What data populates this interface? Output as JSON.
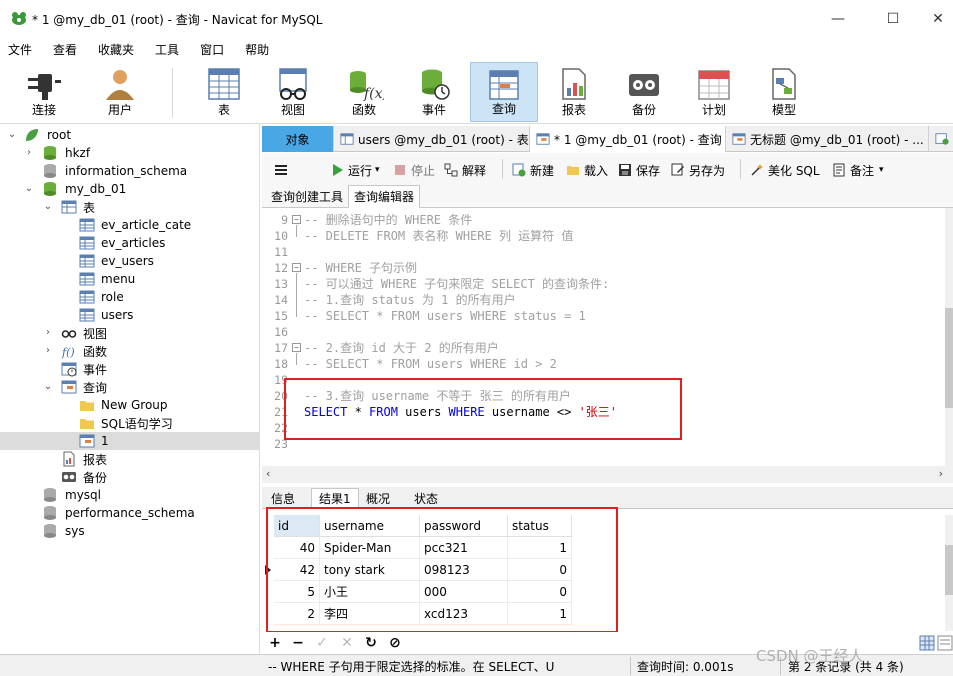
{
  "window": {
    "title": "* 1 @my_db_01 (root) - 查询 - Navicat for MySQL",
    "minimize": "—",
    "maximize": "☐",
    "close": "✕"
  },
  "menu": [
    "文件",
    "查看",
    "收藏夹",
    "工具",
    "窗口",
    "帮助"
  ],
  "ribbon": {
    "connect": "连接",
    "user": "用户",
    "table": "表",
    "view": "视图",
    "function": "函数",
    "event": "事件",
    "query": "查询",
    "report": "报表",
    "backup": "备份",
    "schedule": "计划",
    "model": "模型"
  },
  "tree": {
    "root": "root",
    "hkzf": "hkzf",
    "information_schema": "information_schema",
    "my_db_01": "my_db_01",
    "tables": "表",
    "table_items": [
      "ev_article_cate",
      "ev_articles",
      "ev_users",
      "menu",
      "role",
      "users"
    ],
    "views": "视图",
    "functions": "函数",
    "events": "事件",
    "queries": "查询",
    "query_items": [
      "New Group",
      "SQL语句学习",
      "1"
    ],
    "reports": "报表",
    "backups": "备份",
    "mysql": "mysql",
    "performance_schema": "performance_schema",
    "sys": "sys"
  },
  "tabs": {
    "objects": "对象",
    "tab1": "users @my_db_01 (root) - 表",
    "tab2": "* 1 @my_db_01 (root) - 查询",
    "tab3": "无标题 @my_db_01 (root) - ..."
  },
  "qtoolbar": {
    "run": "运行",
    "stop": "停止",
    "explain": "解释",
    "new": "新建",
    "load": "载入",
    "save": "保存",
    "save_as": "另存为",
    "beautify": "美化 SQL",
    "comment": "备注"
  },
  "subtabs": {
    "builder": "查询创建工具",
    "editor": "查询编辑器"
  },
  "editor": {
    "line_numbers": [
      "9",
      "10",
      "11",
      "12",
      "13",
      "14",
      "15",
      "16",
      "17",
      "18",
      "19",
      "20",
      "21",
      "22",
      "23"
    ],
    "l9": "-- 删除语句中的 WHERE 条件",
    "l10": "-- DELETE FROM 表名称 WHERE 列 运算符 值",
    "l12": "-- WHERE 子句示例",
    "l13": "-- 可以通过 WHERE 子句来限定 SELECT 的查询条件:",
    "l14": "-- 1.查询 status 为 1 的所有用户",
    "l15": "-- SELECT * FROM users WHERE status = 1",
    "l17": "-- 2.查询 id 大于 2 的所有用户",
    "l18": "-- SELECT * FROM users WHERE id > 2",
    "l20": "-- 3.查询 username 不等于 张三 的所有用户",
    "l21_select": "SELECT",
    "l21_star": " * ",
    "l21_from": "FROM",
    "l21_table": " users ",
    "l21_where": "WHERE",
    "l21_cond": " username <> ",
    "l21_str": "'张三'"
  },
  "result_tabs": [
    "信息",
    "结果1",
    "概况",
    "状态"
  ],
  "grid": {
    "columns": [
      "id",
      "username",
      "password",
      "status"
    ],
    "rows": [
      [
        "40",
        "Spider-Man",
        "pcc321",
        "1"
      ],
      [
        "42",
        "tony stark",
        "098123",
        "0"
      ],
      [
        "5",
        "小王",
        "000",
        "0"
      ],
      [
        "2",
        "李四",
        "xcd123",
        "1"
      ]
    ]
  },
  "grid_toolbar": {
    "add": "+",
    "remove": "−",
    "apply": "✓",
    "cancel": "✕",
    "refresh": "↻",
    "stop": "⊘"
  },
  "status": {
    "hint": "-- WHERE 子句用于限定选择的标准。在 SELECT、U",
    "time": "查询时间: 0.001s",
    "record": "第 2 条记录 (共 4 条)"
  },
  "watermark": "CSDN @王经人",
  "colors": {
    "accent": "#4aa7e6",
    "keyword": "#0000e0",
    "string": "#c00000",
    "highlight": "#e02020"
  }
}
